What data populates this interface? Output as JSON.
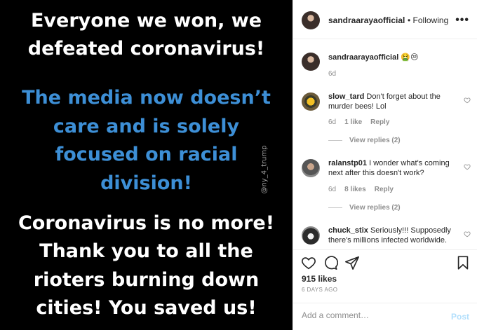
{
  "image": {
    "lines": [
      {
        "text": "Everyone we won, we",
        "color": "white"
      },
      {
        "text": "defeated coronavirus!",
        "color": "white"
      },
      {
        "text": "The media now doesn’t",
        "color": "blue"
      },
      {
        "text": "care and is solely",
        "color": "blue"
      },
      {
        "text": "focused on racial",
        "color": "blue"
      },
      {
        "text": "division!",
        "color": "blue"
      },
      {
        "text": "Coronavirus is no more!",
        "color": "white"
      },
      {
        "text": "Thank you to all the",
        "color": "white"
      },
      {
        "text": "rioters burning down",
        "color": "white"
      },
      {
        "text": "cities! You saved us!",
        "color": "white"
      }
    ],
    "watermark": "@ny_4_trump"
  },
  "header": {
    "username": "sandraarayaofficial",
    "separator": "•",
    "follow_status": "Following",
    "more_icon": "•••"
  },
  "caption": {
    "username": "sandraarayaofficial",
    "emoji": "🤮😒",
    "time": "6d"
  },
  "comments": [
    {
      "username": "slow_tard",
      "text": "Don't forget about the murder bees! Lol",
      "time": "6d",
      "likes": "1 like",
      "reply": "Reply",
      "view_replies": "View replies (2)"
    },
    {
      "username": "ralanstp01",
      "text": "I wonder what's coming next after this doesn't work?",
      "time": "6d",
      "likes": "8 likes",
      "reply": "Reply",
      "view_replies": "View replies (2)"
    },
    {
      "username": "chuck_stix",
      "text": "Seriously!!! Supposedly there's millions infected worldwide."
    }
  ],
  "footer": {
    "likes": "915 likes",
    "date": "6 DAYS AGO",
    "add_comment_placeholder": "Add a comment…",
    "post_label": "Post"
  },
  "colors": {
    "blue_text": "#3d8fd6",
    "post_disabled": "#b2dffc",
    "muted": "#8e8e8e"
  },
  "icons": [
    "more-icon",
    "heart-icon",
    "comment-icon",
    "share-icon",
    "bookmark-icon",
    "comment-like-heart-icon"
  ]
}
